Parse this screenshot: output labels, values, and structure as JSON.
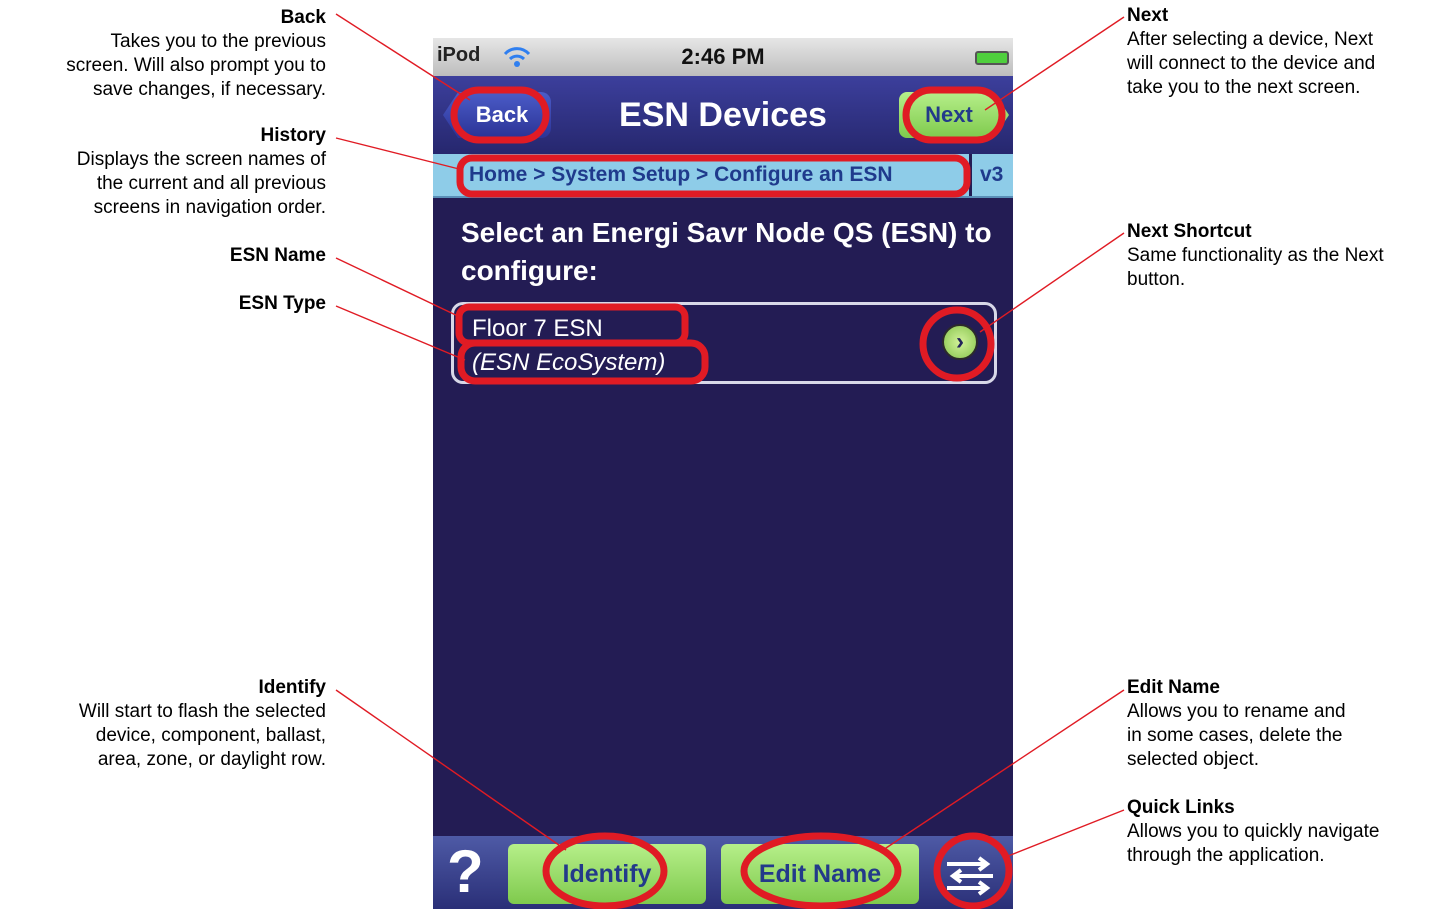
{
  "annotations": {
    "back": {
      "title": "Back",
      "lines": [
        "Takes you to the previous",
        "screen. Will also prompt you to",
        "save changes, if necessary."
      ]
    },
    "history": {
      "title": "History",
      "lines": [
        "Displays the screen names of",
        "the current and all previous",
        "screens in navigation order."
      ]
    },
    "esn_name": {
      "title": "ESN Name"
    },
    "esn_type": {
      "title": "ESN Type"
    },
    "identify": {
      "title": "Identify",
      "lines": [
        "Will start to flash the selected",
        "device, component, ballast,",
        "area, zone, or daylight row."
      ]
    },
    "next": {
      "title": "Next",
      "lines": [
        "After selecting a device, Next",
        "will connect to the device and",
        "take you to the next screen."
      ]
    },
    "next_shortcut": {
      "title": "Next Shortcut",
      "lines": [
        "Same functionality as the Next",
        "button."
      ]
    },
    "edit_name": {
      "title": "Edit Name",
      "lines": [
        "Allows you to rename and",
        "in some cases, delete the",
        "selected object."
      ]
    },
    "quick_links": {
      "title": "Quick Links",
      "lines": [
        "Allows you to quickly navigate",
        "through the application."
      ]
    }
  },
  "phone": {
    "status": {
      "carrier": "iPod",
      "time": "2:46 PM"
    },
    "nav": {
      "back_label": "Back",
      "title": "ESN Devices",
      "next_label": "Next"
    },
    "history": {
      "path": "Home > System Setup > Configure an ESN",
      "version": "v3"
    },
    "prompt": "Select an Energi Savr Node QS (ESN) to configure:",
    "device": {
      "name": "Floor 7 ESN",
      "type": "(ESN EcoSystem)"
    },
    "toolbar": {
      "help": "?",
      "identify_label": "Identify",
      "edit_name_label": "Edit Name"
    }
  },
  "colors": {
    "highlight": "#e01b24",
    "screen_bg": "#231c54",
    "button_green": "#9fdd6b",
    "history_bar": "#8ecce8"
  }
}
